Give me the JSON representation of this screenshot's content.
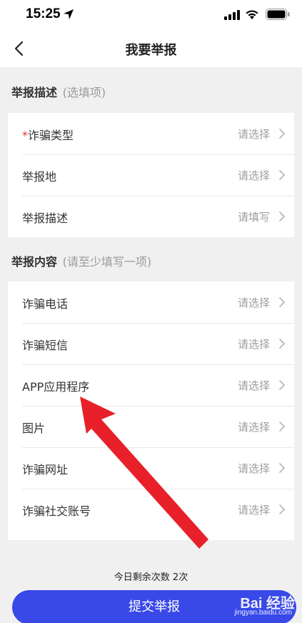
{
  "status_bar": {
    "time": "15:25"
  },
  "nav": {
    "title": "我要举报"
  },
  "section1": {
    "title": "举报描述",
    "hint": "(选填项)",
    "rows": [
      {
        "required_mark": "*",
        "label": "诈骗类型",
        "value": "请选择"
      },
      {
        "label": "举报地",
        "value": "请选择"
      },
      {
        "label": "举报描述",
        "value": "请填写"
      }
    ]
  },
  "section2": {
    "title": "举报内容",
    "hint": "(请至少填写一项)",
    "rows": [
      {
        "label": "诈骗电话",
        "value": "请选择"
      },
      {
        "label": "诈骗短信",
        "value": "请选择"
      },
      {
        "label": "APP应用程序",
        "value": "请选择"
      },
      {
        "label": "图片",
        "value": "请选择"
      },
      {
        "label": "诈骗网址",
        "value": "请选择"
      },
      {
        "label": "诈骗社交账号",
        "value": "请选择"
      }
    ]
  },
  "footer": {
    "remaining_text": "今日剩余次数 2次",
    "submit_label": "提交举报"
  },
  "watermark": {
    "main": "Bai 经验",
    "sub": "jingyan.baidu.com"
  },
  "colors": {
    "accent": "#3949e8",
    "arrow": "#e8202a",
    "required": "#e53935"
  }
}
